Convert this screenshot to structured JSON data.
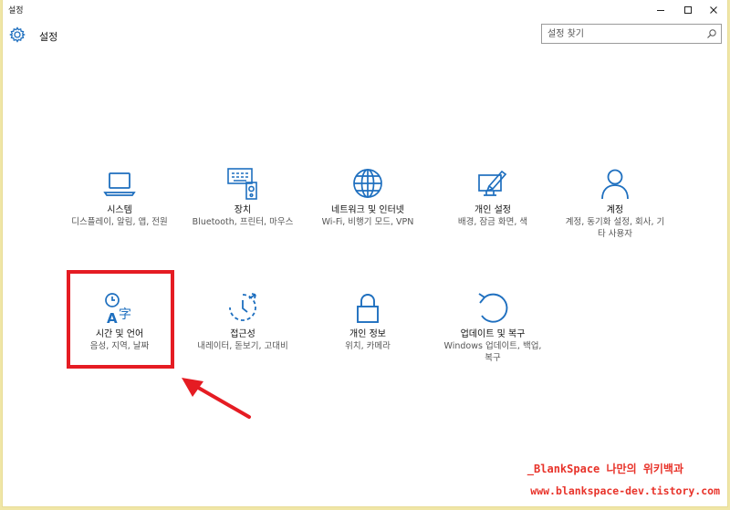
{
  "window": {
    "title": "설정"
  },
  "header": {
    "title": "설정",
    "search_placeholder": "설정 찾기"
  },
  "tiles": [
    {
      "label": "시스템",
      "desc": "디스플레이, 알림, 앱, 전원",
      "icon": "laptop-icon"
    },
    {
      "label": "장치",
      "desc": "Bluetooth, 프린터, 마우스",
      "icon": "devices-icon"
    },
    {
      "label": "네트워크 및 인터넷",
      "desc": "Wi-Fi, 비행기 모드, VPN",
      "icon": "globe-icon"
    },
    {
      "label": "개인 설정",
      "desc": "배경, 잠금 화면, 색",
      "icon": "personalization-icon"
    },
    {
      "label": "계정",
      "desc": "계정, 동기화 설정, 회사, 기타 사용자",
      "icon": "person-icon"
    },
    {
      "label": "시간 및 언어",
      "desc": "음성, 지역, 날짜",
      "icon": "time-language-icon"
    },
    {
      "label": "접근성",
      "desc": "내레이터, 돋보기, 고대비",
      "icon": "ease-of-access-icon"
    },
    {
      "label": "개인 정보",
      "desc": "위치, 카메라",
      "icon": "lock-icon"
    },
    {
      "label": "업데이트 및 복구",
      "desc": "Windows 업데이트, 백업, 복구",
      "icon": "refresh-icon"
    }
  ],
  "watermark": {
    "line1": "_BlankSpace 나만의 위키백과",
    "line2": "www.blankspace-dev.tistory.com"
  },
  "colors": {
    "accent": "#1e6fbf",
    "highlight": "#e51c23"
  }
}
